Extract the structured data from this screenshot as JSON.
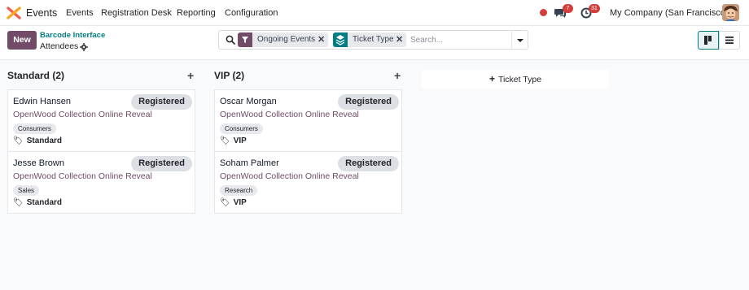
{
  "navbar": {
    "app_name": "Events",
    "menu": [
      "Events",
      "Registration Desk",
      "Reporting",
      "Configuration"
    ],
    "messages_count": "7",
    "activities_count": "31",
    "company": "My Company (San Francisco)"
  },
  "control_panel": {
    "new_label": "New",
    "breadcrumb_parent": "Barcode Interface",
    "breadcrumb_current": "Attendees",
    "facets": [
      {
        "label": "Ongoing Events",
        "icon": "filter-icon",
        "color": "#714b67"
      },
      {
        "label": "Ticket Type",
        "icon": "layers-icon",
        "color": "#017e84"
      }
    ],
    "search_placeholder": "Search..."
  },
  "kanban": {
    "columns": [
      {
        "title": "Standard (2)",
        "cards": [
          {
            "name": "Edwin Hansen",
            "status": "Registered",
            "event": "OpenWood Collection Online Reveal",
            "tag": "Consumers",
            "ticket": "Standard"
          },
          {
            "name": "Jesse Brown",
            "status": "Registered",
            "event": "OpenWood Collection Online Reveal",
            "tag": "Sales",
            "ticket": "Standard"
          }
        ]
      },
      {
        "title": "VIP (2)",
        "cards": [
          {
            "name": "Oscar Morgan",
            "status": "Registered",
            "event": "OpenWood Collection Online Reveal",
            "tag": "Consumers",
            "ticket": "VIP"
          },
          {
            "name": "Soham Palmer",
            "status": "Registered",
            "event": "OpenWood Collection Online Reveal",
            "tag": "Research",
            "ticket": "VIP"
          }
        ]
      }
    ],
    "add_column_label": "Ticket Type"
  },
  "colors": {
    "brand": "#714b67",
    "accent": "#017e84",
    "badge": "#d23f3a"
  }
}
